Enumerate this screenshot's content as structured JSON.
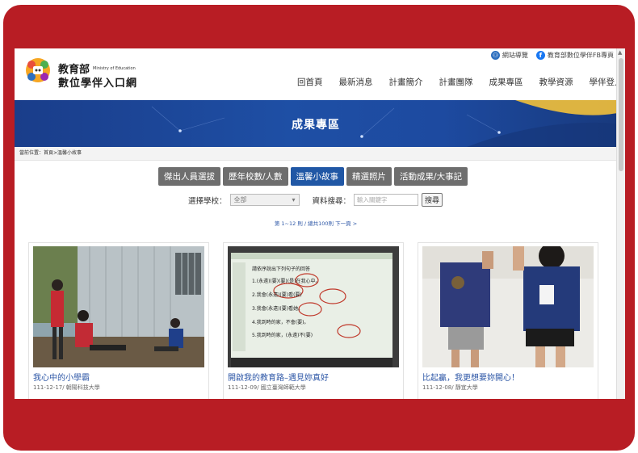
{
  "header": {
    "logo_title": "教育部",
    "logo_en": "Ministry of Education",
    "logo_subtitle": "數位學伴入口網",
    "toplinks": {
      "sitemap": "網站導覽",
      "fb": "教育部數位學伴FB專頁"
    },
    "nav": [
      "回首頁",
      "最新消息",
      "計畫簡介",
      "計畫團隊",
      "成果專區",
      "教學資源",
      "學伴登入"
    ]
  },
  "banner": {
    "title": "成果專區"
  },
  "breadcrumb": "當前位置：首頁>溫馨小故事",
  "tabs": [
    {
      "label": "傑出人員選拔",
      "active": false
    },
    {
      "label": "歷年校數/人數",
      "active": false
    },
    {
      "label": "溫馨小故事",
      "active": true
    },
    {
      "label": "精選照片",
      "active": false
    },
    {
      "label": "活動成果/大事記",
      "active": false
    }
  ],
  "filter": {
    "school_label": "選擇學校：",
    "school_value": "全部",
    "search_label": "資料搜尋：",
    "search_placeholder": "輸入關鍵字",
    "search_button": "搜尋"
  },
  "pager": "第 1~12 則 / 總共100則 下一頁 >",
  "cards": [
    {
      "title": "我心中的小學霸",
      "meta": "111-12-17/ 朝陽科技大學"
    },
    {
      "title": "開啟我的教育路–遇見妳真好",
      "meta": "111-12-09/ 國立臺灣師範大學"
    },
    {
      "title": "比起贏，我更想要妳開心！",
      "meta": "111-12-08/ 靜宜大學"
    }
  ],
  "photo2_text": [
    "請依序說出下列句子的回答",
    "1.(永遠)(要)(要)(是)在我心中。",
    "2.我會(永遠)(要)看(要)",
    "3.我會(永遠)(要)看她。",
    "4.我到時的家，不會(要)。",
    "5.我到時的家，(永遠)不(要)"
  ],
  "colors": {
    "frame": "#b81d24",
    "banner": "#1e4fa5",
    "tab_active": "#2057a5",
    "tab": "#6e6e6e",
    "link": "#2c56a6"
  }
}
